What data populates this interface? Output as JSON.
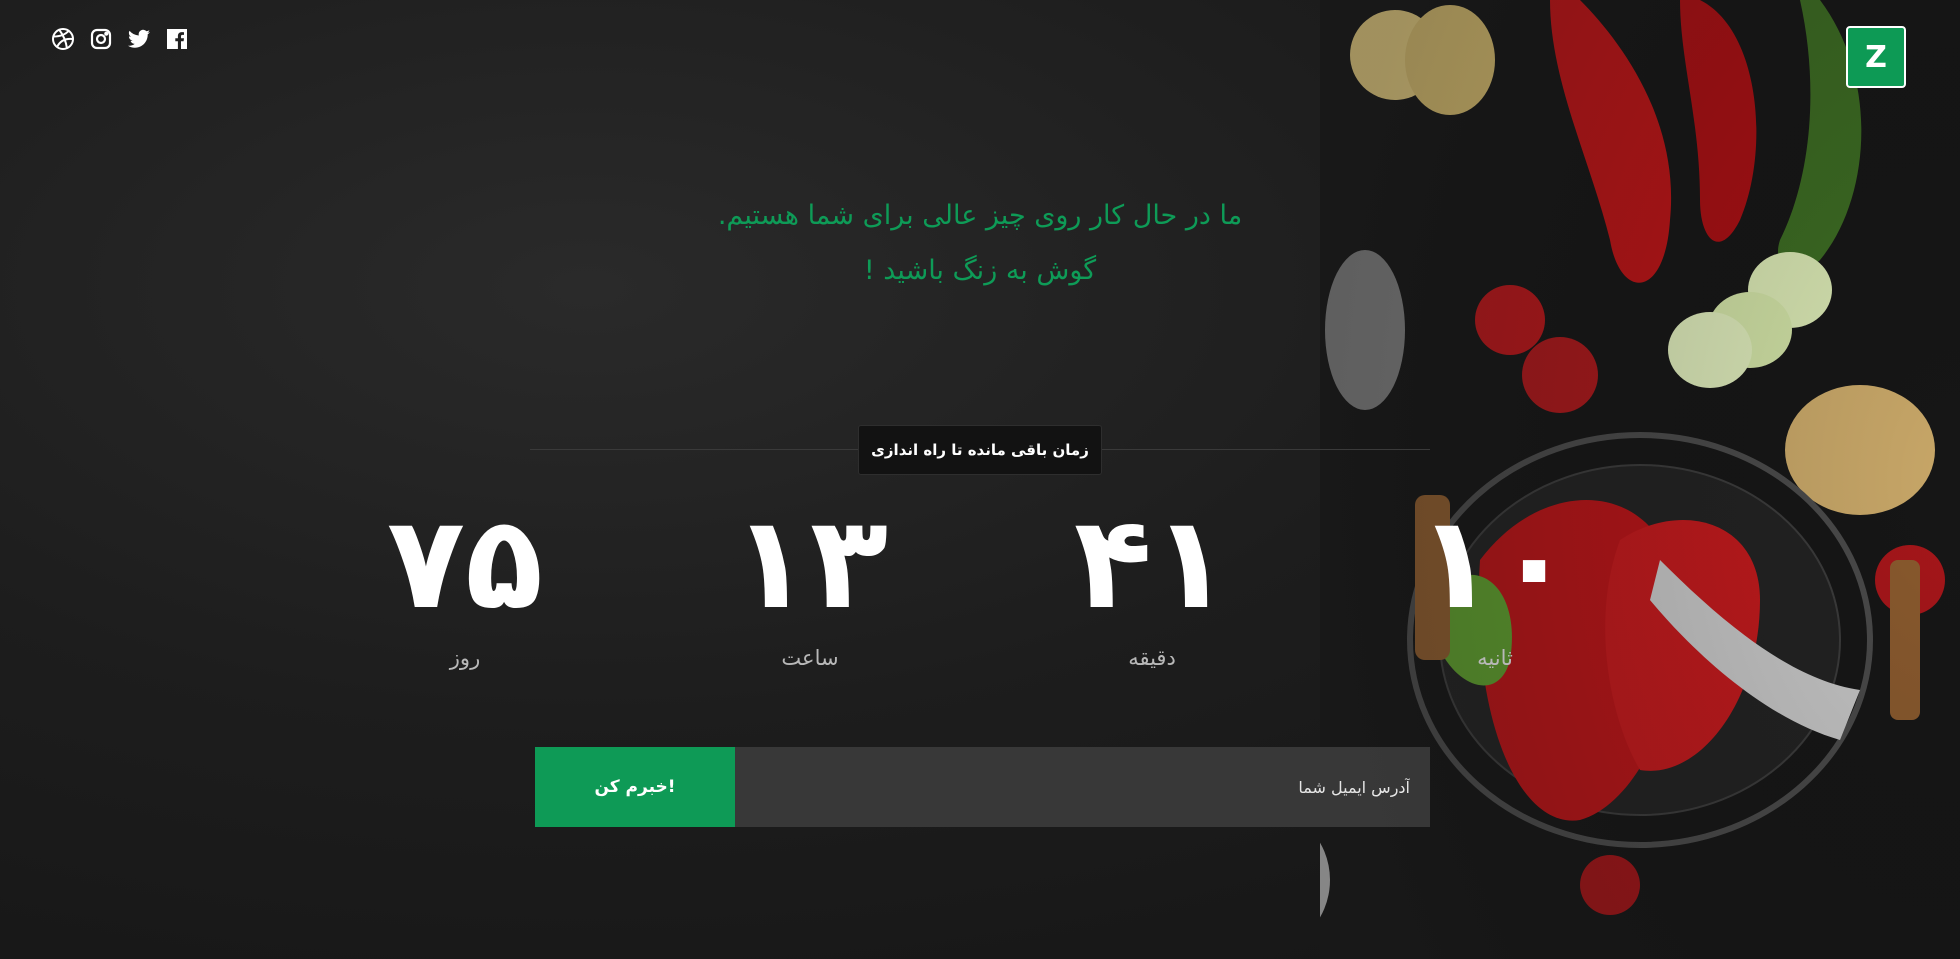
{
  "social": [
    {
      "name": "dribbble-icon"
    },
    {
      "name": "instagram-icon"
    },
    {
      "name": "twitter-icon"
    },
    {
      "name": "facebook-icon"
    }
  ],
  "logo": {
    "text": "Z",
    "color": "#0d9a55"
  },
  "headline": {
    "line1": "ما در حال کار روی چیز عالی برای شما هستیم.",
    "line2": "گوش به زنگ باشید !"
  },
  "countdown": {
    "label": "زمان باقی مانده تا راه اندازی",
    "days": {
      "value": "۷۵",
      "label": "روز"
    },
    "hours": {
      "value": "۱۳",
      "label": "ساعت"
    },
    "minutes": {
      "value": "۴۱",
      "label": "دقیقه"
    },
    "seconds": {
      "value": "۱۰",
      "label": "ثانیه"
    }
  },
  "subscribe": {
    "placeholder": "آدرس ایمیل شما",
    "button": "خبرم کن!"
  },
  "colors": {
    "accent": "#0e9a56",
    "background": "#1c1c1c"
  }
}
